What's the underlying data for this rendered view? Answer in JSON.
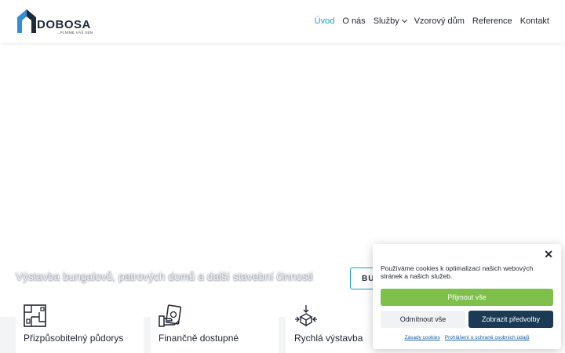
{
  "brand": {
    "name": "DOBOSA",
    "tagline": "...PLNÍME VÁŠ SEN",
    "colors": {
      "primary": "#1f2a3a",
      "accent": "#1a9fbf",
      "mark": "#2f8fd8"
    }
  },
  "nav": {
    "items": [
      {
        "label": "Úvod",
        "active": true
      },
      {
        "label": "O nás"
      },
      {
        "label": "Služby",
        "has_dropdown": true
      },
      {
        "label": "Vzorový dům"
      },
      {
        "label": "Reference"
      },
      {
        "label": "Kontakt"
      }
    ]
  },
  "hero": {
    "subtitle": "Výstavba bungalovů, patrových domů a další stavební činnosti",
    "button_label": "BU"
  },
  "features": [
    {
      "label": "Přizpůsobitelný půdorys",
      "icon": "floor-plan-icon"
    },
    {
      "label": "Finančně dostupné",
      "icon": "money-hand-icon"
    },
    {
      "label": "Rychlá výstavba",
      "icon": "box-arrows-icon"
    }
  ],
  "cookie": {
    "text": "Používáme cookies k optimalizaci našich webových stránek a našich služeb.",
    "accept_label": "Přijmout vše",
    "deny_label": "Odmítnout vše",
    "prefs_label": "Zobrazit předvolby",
    "link_cookies": "Zásady cookies",
    "link_privacy": "Prohlášení o ochraně osobních údajů",
    "colors": {
      "accept": "#7ec04a",
      "prefs": "#1a3a55"
    }
  }
}
